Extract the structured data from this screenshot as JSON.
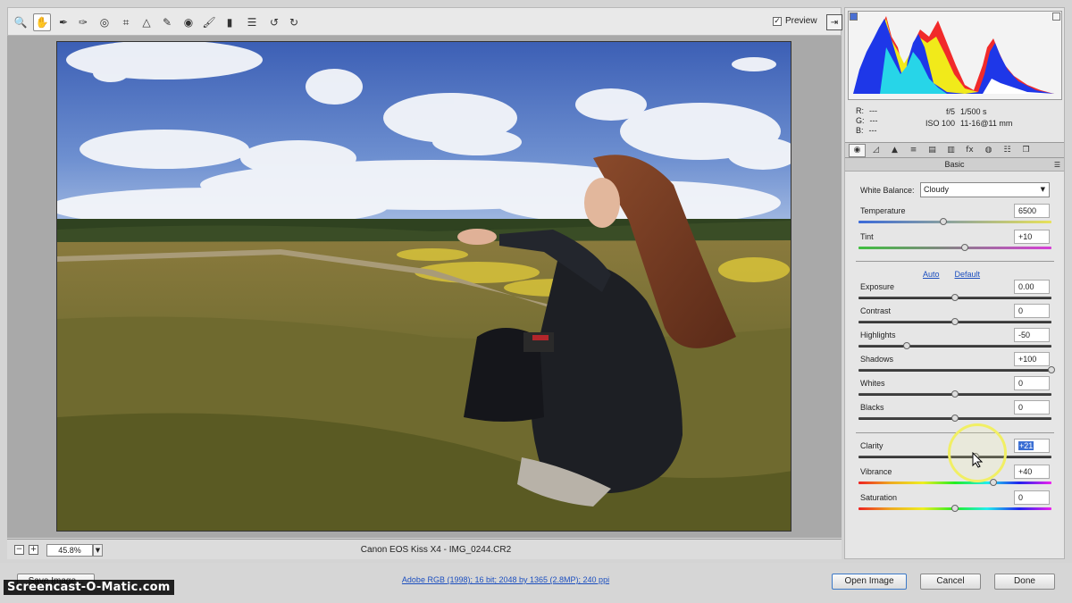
{
  "toolbar": {
    "tools": [
      {
        "name": "zoom-tool",
        "glyph": "🔍"
      },
      {
        "name": "hand-tool",
        "glyph": "✋"
      },
      {
        "name": "white-balance-tool",
        "glyph": "✒"
      },
      {
        "name": "color-sampler-tool",
        "glyph": "✑"
      },
      {
        "name": "targeted-adjustment-tool",
        "glyph": "◎"
      },
      {
        "name": "crop-tool",
        "glyph": "⌗"
      },
      {
        "name": "straighten-tool",
        "glyph": "△"
      },
      {
        "name": "spot-removal-tool",
        "glyph": "✎"
      },
      {
        "name": "red-eye-tool",
        "glyph": "◉"
      },
      {
        "name": "adjustment-brush-tool",
        "glyph": "🖌"
      },
      {
        "name": "graduated-filter-tool",
        "glyph": "▮"
      },
      {
        "name": "preferences-tool",
        "glyph": "☰"
      },
      {
        "name": "rotate-left-tool",
        "glyph": "↺"
      },
      {
        "name": "rotate-right-tool",
        "glyph": "↻"
      }
    ],
    "preview_label": "Preview",
    "preview_checked": "✓"
  },
  "status_bar": {
    "zoom_out": "−",
    "zoom_in": "+",
    "zoom": "45.8%",
    "filename": "Canon EOS Kiss X4  -  IMG_0244.CR2"
  },
  "info": {
    "r_label": "R:",
    "r_value": "---",
    "g_label": "G:",
    "g_value": "---",
    "b_label": "B:",
    "b_value": "---",
    "aperture": "f/5",
    "shutter": "1/500 s",
    "iso": "ISO 100",
    "lens": "11-16@11 mm"
  },
  "panel": {
    "title": "Basic",
    "white_balance_label": "White Balance:",
    "white_balance_value": "Cloudy",
    "auto_label": "Auto",
    "default_label": "Default",
    "sliders": [
      {
        "label": "Temperature",
        "value": "6500",
        "position": 0.44,
        "track": "temp"
      },
      {
        "label": "Tint",
        "value": "+10",
        "position": 0.55,
        "track": "tint"
      },
      {
        "label": "Exposure",
        "value": "0.00",
        "position": 0.5,
        "track": "dark"
      },
      {
        "label": "Contrast",
        "value": "0",
        "position": 0.5,
        "track": "dark"
      },
      {
        "label": "Highlights",
        "value": "-50",
        "position": 0.25,
        "track": "dark"
      },
      {
        "label": "Shadows",
        "value": "+100",
        "position": 1.0,
        "track": "dark"
      },
      {
        "label": "Whites",
        "value": "0",
        "position": 0.5,
        "track": "dark"
      },
      {
        "label": "Blacks",
        "value": "0",
        "position": 0.5,
        "track": "dark"
      },
      {
        "label": "Clarity",
        "value": "+21",
        "position": 0.605,
        "track": "dark",
        "selected": true
      },
      {
        "label": "Vibrance",
        "value": "+40",
        "position": 0.7,
        "track": "rainbow"
      },
      {
        "label": "Saturation",
        "value": "0",
        "position": 0.5,
        "track": "rainbow"
      }
    ]
  },
  "bottom_bar": {
    "save_label": "Save Image...",
    "workflow_label": "Adobe RGB (1998); 16 bit; 2048 by 1365 (2.8MP); 240 ppi",
    "open_label": "Open Image",
    "cancel_label": "Cancel",
    "done_label": "Done",
    "watermark": "Screencast-O-Matic.com"
  }
}
